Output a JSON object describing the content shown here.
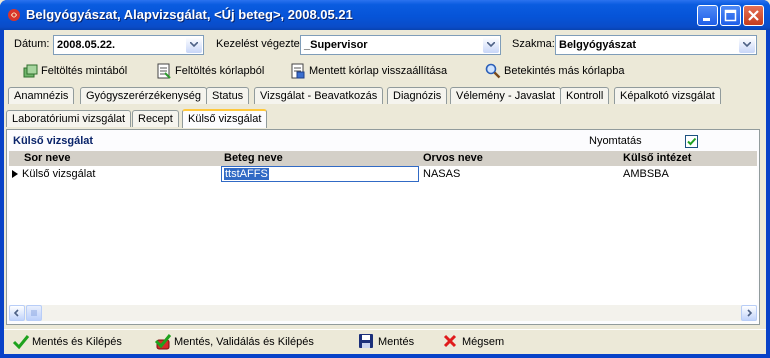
{
  "window": {
    "title": "Belgyógyászat, Alapvizsgálat, <Új beteg>, 2008.05.21",
    "colors": {
      "titlebar": "#0654d8",
      "accent_tab": "#ffc83c",
      "selection": "#316ac5"
    }
  },
  "header": {
    "datum_label": "Dátum:",
    "datum_value": "2008.05.22.",
    "kezelest_label": "Kezelést végezte:",
    "kezelest_value": "_Supervisor",
    "szakma_label": "Szakma:",
    "szakma_value": "Belgyógyászat"
  },
  "toolbar": {
    "items": [
      {
        "label": "Feltöltés mintából",
        "icon": "template-fill-icon"
      },
      {
        "label": "Feltöltés kórlapból",
        "icon": "record-fill-icon"
      },
      {
        "label": "Mentett kórlap visszaállítása",
        "icon": "restore-record-icon"
      },
      {
        "label": "Betekintés más kórlapba",
        "icon": "magnifier-icon"
      }
    ]
  },
  "tabs_row1": [
    "Anamnézis",
    "Gyógyszerérzékenység",
    "Status",
    "Vizsgálat - Beavatkozás",
    "Diagnózis",
    "Vélemény - Javaslat",
    "Kontroll",
    "Képalkotó vizsgálat"
  ],
  "tabs_row2": [
    "Laboratóriumi vizsgálat",
    "Recept",
    "Külső vizsgálat"
  ],
  "active_tab": "Külső vizsgálat",
  "panel": {
    "title": "Külső vizsgálat",
    "print_label": "Nyomtatás",
    "print_checked": true
  },
  "grid": {
    "columns": [
      "Sor neve",
      "Beteg neve",
      "Orvos neve",
      "Külső intézet"
    ],
    "rows": [
      {
        "sor_neve": "Külső vizsgálat",
        "beteg_neve": "ttstAFFS",
        "orvos_neve": "NASAS",
        "kulso_intezet": "AMBSBA"
      }
    ]
  },
  "footer": {
    "buttons": [
      {
        "label": "Mentés és Kilépés",
        "icon": "checkmark-icon"
      },
      {
        "label": "Mentés, Validálás és Kilépés",
        "icon": "validate-icon"
      },
      {
        "label": "Mentés",
        "icon": "floppy-disk-icon"
      },
      {
        "label": "Mégsem",
        "icon": "red-x-icon"
      }
    ]
  }
}
